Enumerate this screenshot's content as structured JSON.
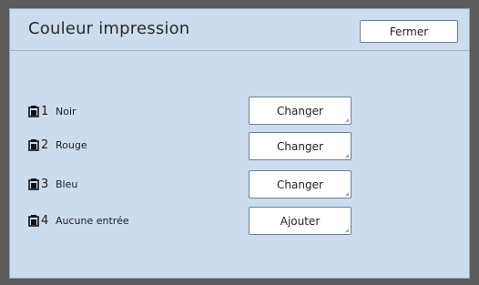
{
  "window": {
    "title": "Couleur impression",
    "close_label": "Fermer"
  },
  "drums": [
    {
      "number": "1",
      "label": "Noir",
      "action": "Changer"
    },
    {
      "number": "2",
      "label": "Rouge",
      "action": "Changer"
    },
    {
      "number": "3",
      "label": "Bleu",
      "action": "Changer"
    },
    {
      "number": "4",
      "label": "Aucune entrée",
      "action": "Ajouter"
    }
  ],
  "colors": {
    "panel_background": "#cbdcef",
    "frame": "#5c5c5c",
    "button_background": "#ffffff"
  },
  "icons": {
    "drum": "ink-drum-icon"
  }
}
